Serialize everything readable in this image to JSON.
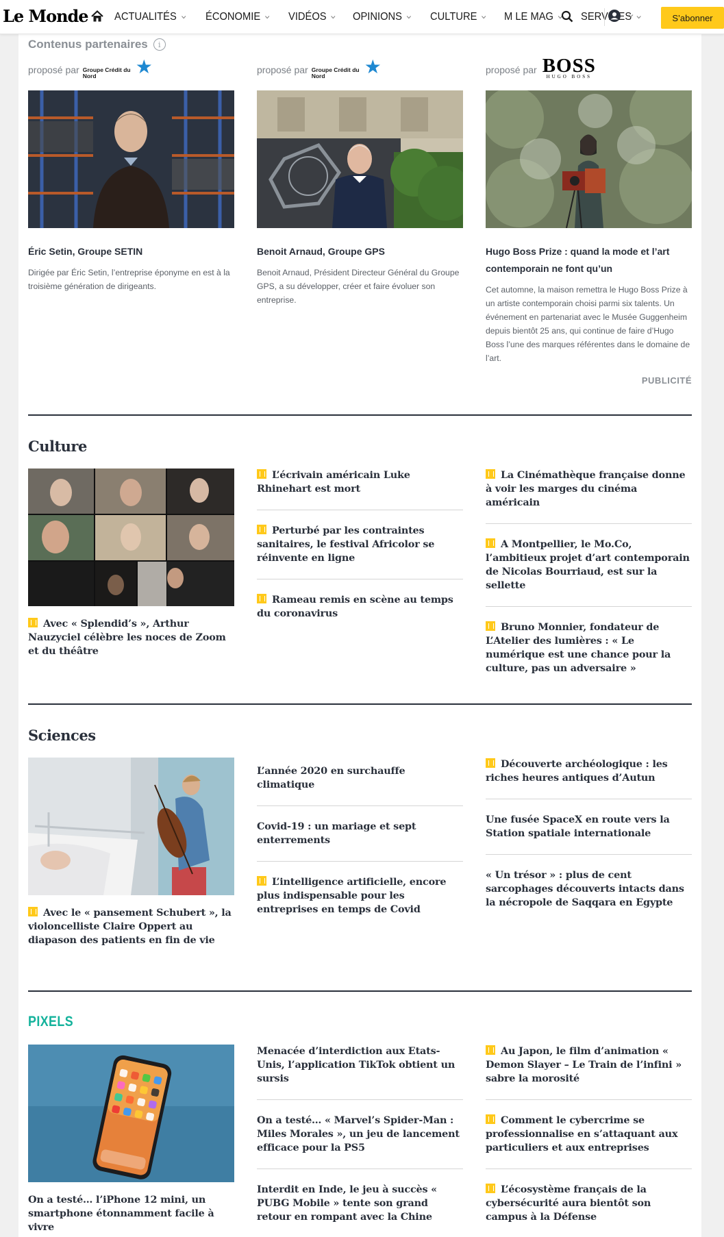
{
  "header": {
    "logo": "Le Monde",
    "nav": [
      "ACTUALITÉS",
      "ÉCONOMIE",
      "VIDÉOS",
      "OPINIONS",
      "CULTURE",
      "M LE MAG",
      "SERVICES"
    ],
    "subscribe": "S’abonner"
  },
  "partners": {
    "title": "Contenus partenaires",
    "proposed": "proposé par",
    "sponsor_cdn": "Groupe Crédit du Nord",
    "sponsor_boss": "BOSS",
    "sponsor_boss_sub": "HUGO BOSS",
    "items": [
      {
        "title": "Éric Setin, Groupe SETIN",
        "desc": "Dirigée par Éric Setin, l’entreprise éponyme en est à la troisième génération de dirigeants."
      },
      {
        "title": "Benoit Arnaud, Groupe GPS",
        "desc": "Benoit Arnaud, Président Directeur Général du Groupe GPS, a su développer, créer et faire évoluer son entreprise."
      },
      {
        "title": "Hugo Boss Prize : quand la mode et l’art contemporain ne font qu’un",
        "desc": "Cet automne, la maison remettra le Hugo Boss Prize à un artiste contemporain choisi parmi six talents. Un événement en partenariat avec le Musée Guggenheim depuis bientôt 25 ans, qui continue de faire d’Hugo Boss l’une des marques référentes dans le domaine de l’art."
      }
    ],
    "ad_label": "PUBLICITÉ"
  },
  "culture": {
    "title": "Culture",
    "lead": "Avec « Splendid’s », Arthur Nauzyciel célèbre les noces de Zoom et du théâtre",
    "col2": [
      "L’écrivain américain Luke Rhinehart est mort",
      "Perturbé par les contraintes sanitaires, le festival Africolor se réinvente en ligne",
      "Rameau remis en scène au temps du coronavirus"
    ],
    "col3": [
      "La Cinémathèque française donne à voir les marges du cinéma américain",
      "A Montpellier, le Mo.Co, l’ambitieux projet d’art contemporain de Nicolas Bourriaud, est sur la sellette",
      "Bruno Monnier, fondateur de L’Atelier des lumières : « Le numérique est une chance pour la culture, pas un adversaire »"
    ]
  },
  "sciences": {
    "title": "Sciences",
    "lead": "Avec le « pansement Schubert », la violoncelliste Claire Oppert au diapason des patients en fin de vie",
    "col2": [
      "L’année 2020 en surchauffe climatique",
      "Covid-19 : un mariage et sept enterrements",
      "L’intelligence artificielle, encore plus indispensable pour les entreprises en temps de Covid"
    ],
    "col3": [
      "Découverte archéologique : les riches heures antiques d’Autun",
      "Une fusée SpaceX en route vers la Station spatiale internationale",
      "« Un trésor » : plus de cent sarcophages découverts intacts dans la nécropole de Saqqara en Egypte"
    ]
  },
  "pixels": {
    "title": "PIXELS",
    "lead": "On a testé… l’iPhone 12 mini, un smartphone étonnamment facile à vivre",
    "col2": [
      "Menacée d’interdiction aux Etats-Unis, l’application TikTok obtient un sursis",
      "On a testé… « Marvel’s Spider-Man : Miles Morales », un jeu de lancement efficace pour la PS5",
      "Interdit en Inde, le jeu à succès « PUBG Mobile » tente son grand retour en rompant avec la Chine"
    ],
    "col3": [
      "Au Japon, le film d’animation « Demon Slayer – Le Train de l’infini » sabre la morosité",
      "Comment le cybercrime se professionnalise en s’attaquant aux particuliers et aux entreprises",
      "L’écosystème français de la cybersécurité aura bientôt son campus à la Défense"
    ]
  }
}
